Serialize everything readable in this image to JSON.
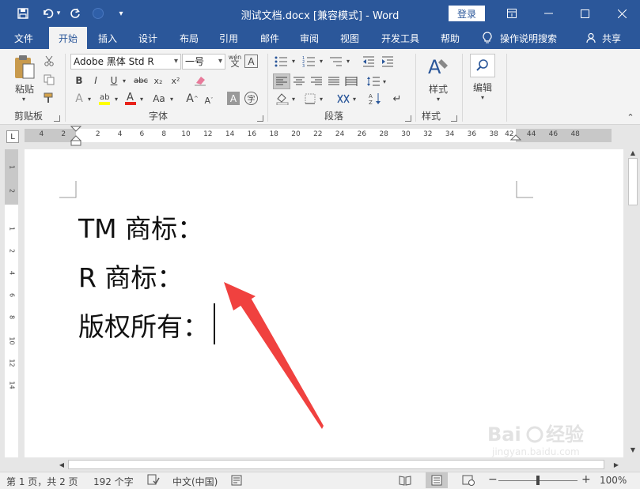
{
  "window": {
    "title": "测试文档.docx [兼容模式] - Word",
    "login_label": "登录"
  },
  "tabs": [
    "文件",
    "开始",
    "插入",
    "设计",
    "布局",
    "引用",
    "邮件",
    "审阅",
    "视图",
    "开发工具",
    "帮助"
  ],
  "active_tab": "开始",
  "tell_me": "操作说明搜索",
  "share": "共享",
  "ribbon": {
    "clipboard": {
      "paste": "粘贴",
      "label": "剪贴板"
    },
    "font": {
      "family": "Adobe 黑体 Std R",
      "size": "一号",
      "label": "字体",
      "phonetic": "wén"
    },
    "paragraph": {
      "label": "段落"
    },
    "styles": {
      "button": "样式",
      "label": "样式"
    },
    "editing": {
      "button": "编辑"
    }
  },
  "ruler": {
    "left_numbers": [
      "4",
      "2"
    ],
    "right_numbers": [
      "2",
      "4",
      "6",
      "8",
      "10",
      "12",
      "14",
      "16",
      "18",
      "20",
      "22",
      "24",
      "26",
      "28",
      "30",
      "32",
      "34",
      "36",
      "38"
    ],
    "margin_numbers": [
      "42",
      "44",
      "46",
      "48"
    ],
    "vertical_numbers": [
      "1",
      "2",
      "1",
      "2",
      "4",
      "6",
      "8",
      "10",
      "12",
      "14"
    ]
  },
  "document": {
    "lines": [
      "TM 商标：",
      "R 商标：",
      "版权所有："
    ]
  },
  "status": {
    "page": "第 1 页，共 2 页",
    "words": "192 个字",
    "language": "中文(中国)",
    "zoom": "100%"
  },
  "colors": {
    "title_bar": "#2b579a",
    "annotation_arrow": "#f0413f"
  },
  "watermark": "Baidu 经验 jingyan.baidu.com"
}
